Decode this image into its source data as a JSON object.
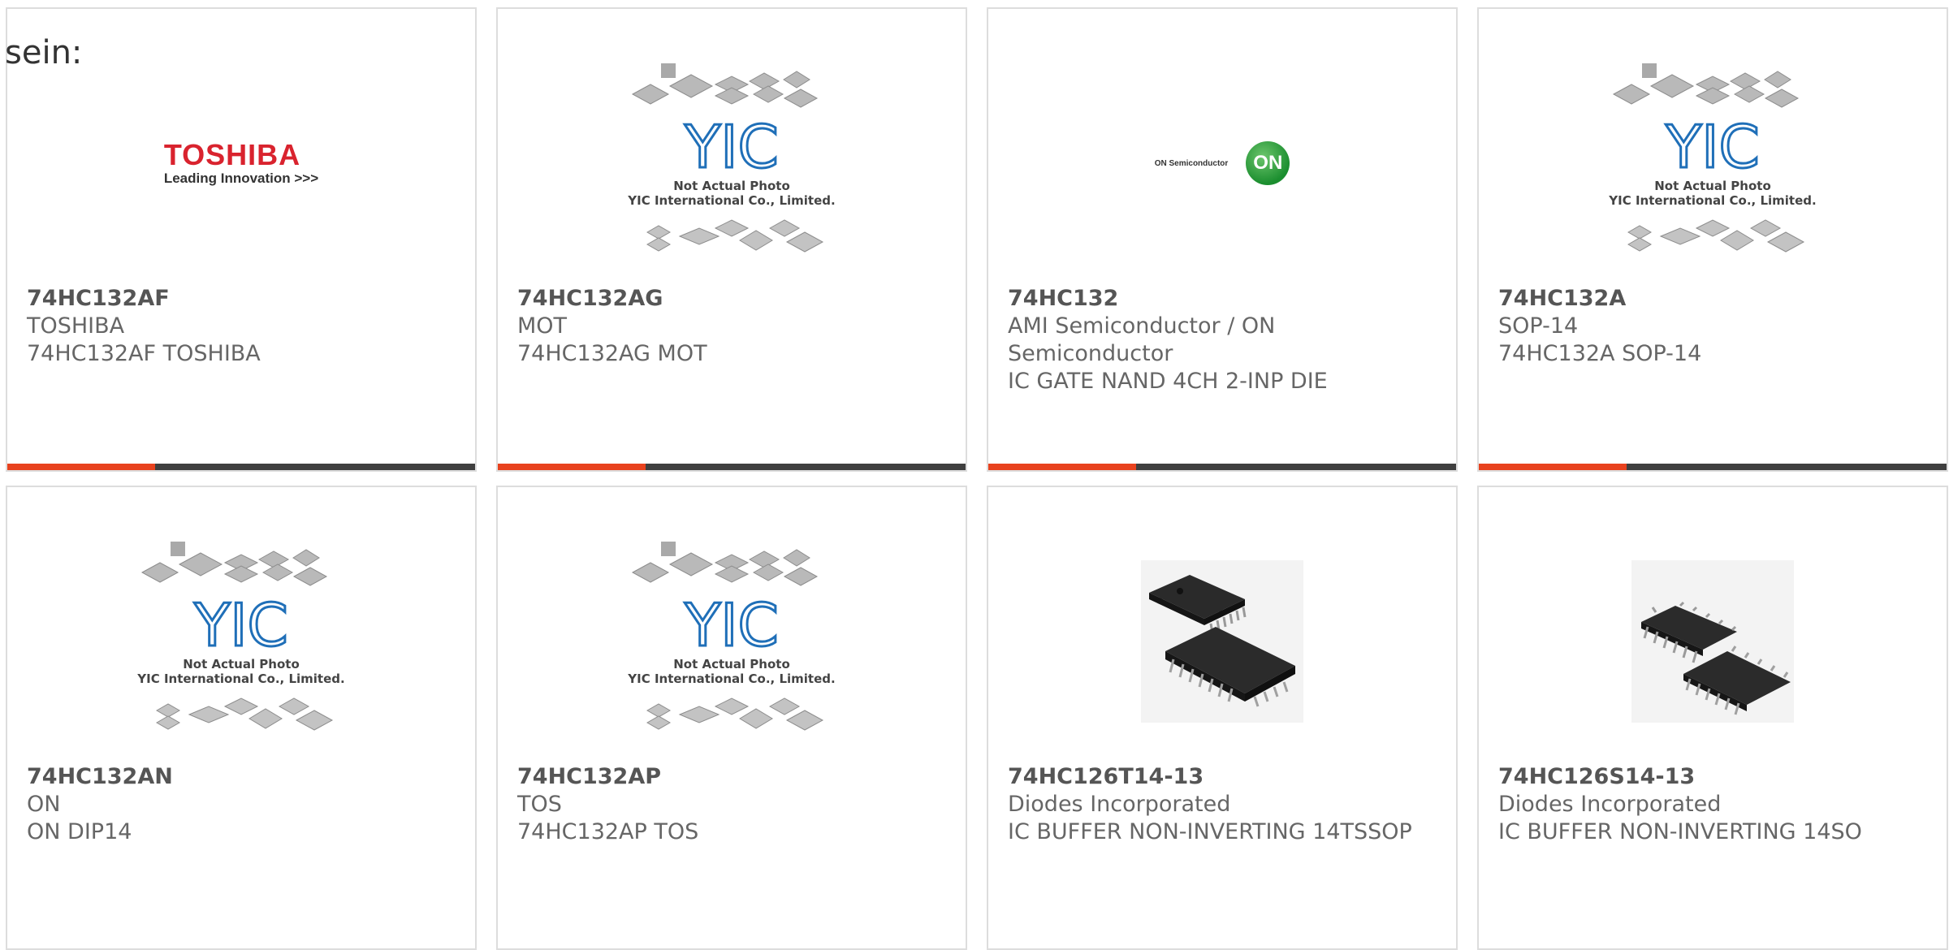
{
  "page": {
    "label": "sein:"
  },
  "colors": {
    "accent": "#e8421e",
    "bar_dark": "#3f3f3f",
    "border": "#dddddd",
    "text": "#666666"
  },
  "yic": {
    "line1": "Not Actual Photo",
    "line2": "YIC International Co., Limited."
  },
  "logos": {
    "toshiba": {
      "name": "TOSHIBA",
      "tagline": "Leading Innovation >>>"
    },
    "onsemi": {
      "name": "ON Semiconductor",
      "mark": "ON"
    }
  },
  "products": [
    {
      "part": "74HC132AF",
      "manufacturer": "TOSHIBA",
      "description": "74HC132AF TOSHIBA",
      "image": "toshiba-logo"
    },
    {
      "part": "74HC132AG",
      "manufacturer": "MOT",
      "description": "74HC132AG MOT",
      "image": "yic-placeholder"
    },
    {
      "part": "74HC132",
      "manufacturer": "AMI Semiconductor / ON Semiconductor",
      "description": "IC GATE NAND 4CH 2-INP DIE",
      "image": "onsemi-logo"
    },
    {
      "part": "74HC132A",
      "manufacturer": "SOP-14",
      "description": "74HC132A SOP-14",
      "image": "yic-placeholder"
    },
    {
      "part": "74HC132AN",
      "manufacturer": "ON",
      "description": "ON DIP14",
      "image": "yic-placeholder"
    },
    {
      "part": "74HC132AP",
      "manufacturer": "TOS",
      "description": "74HC132AP TOS",
      "image": "yic-placeholder"
    },
    {
      "part": "74HC126T14-13",
      "manufacturer": "Diodes Incorporated",
      "description": "IC BUFFER NON-INVERTING 14TSSOP",
      "image": "chip-tssop-photo"
    },
    {
      "part": "74HC126S14-13",
      "manufacturer": "Diodes Incorporated",
      "description": "IC BUFFER NON-INVERTING 14SO",
      "image": "chip-so-photo"
    }
  ]
}
